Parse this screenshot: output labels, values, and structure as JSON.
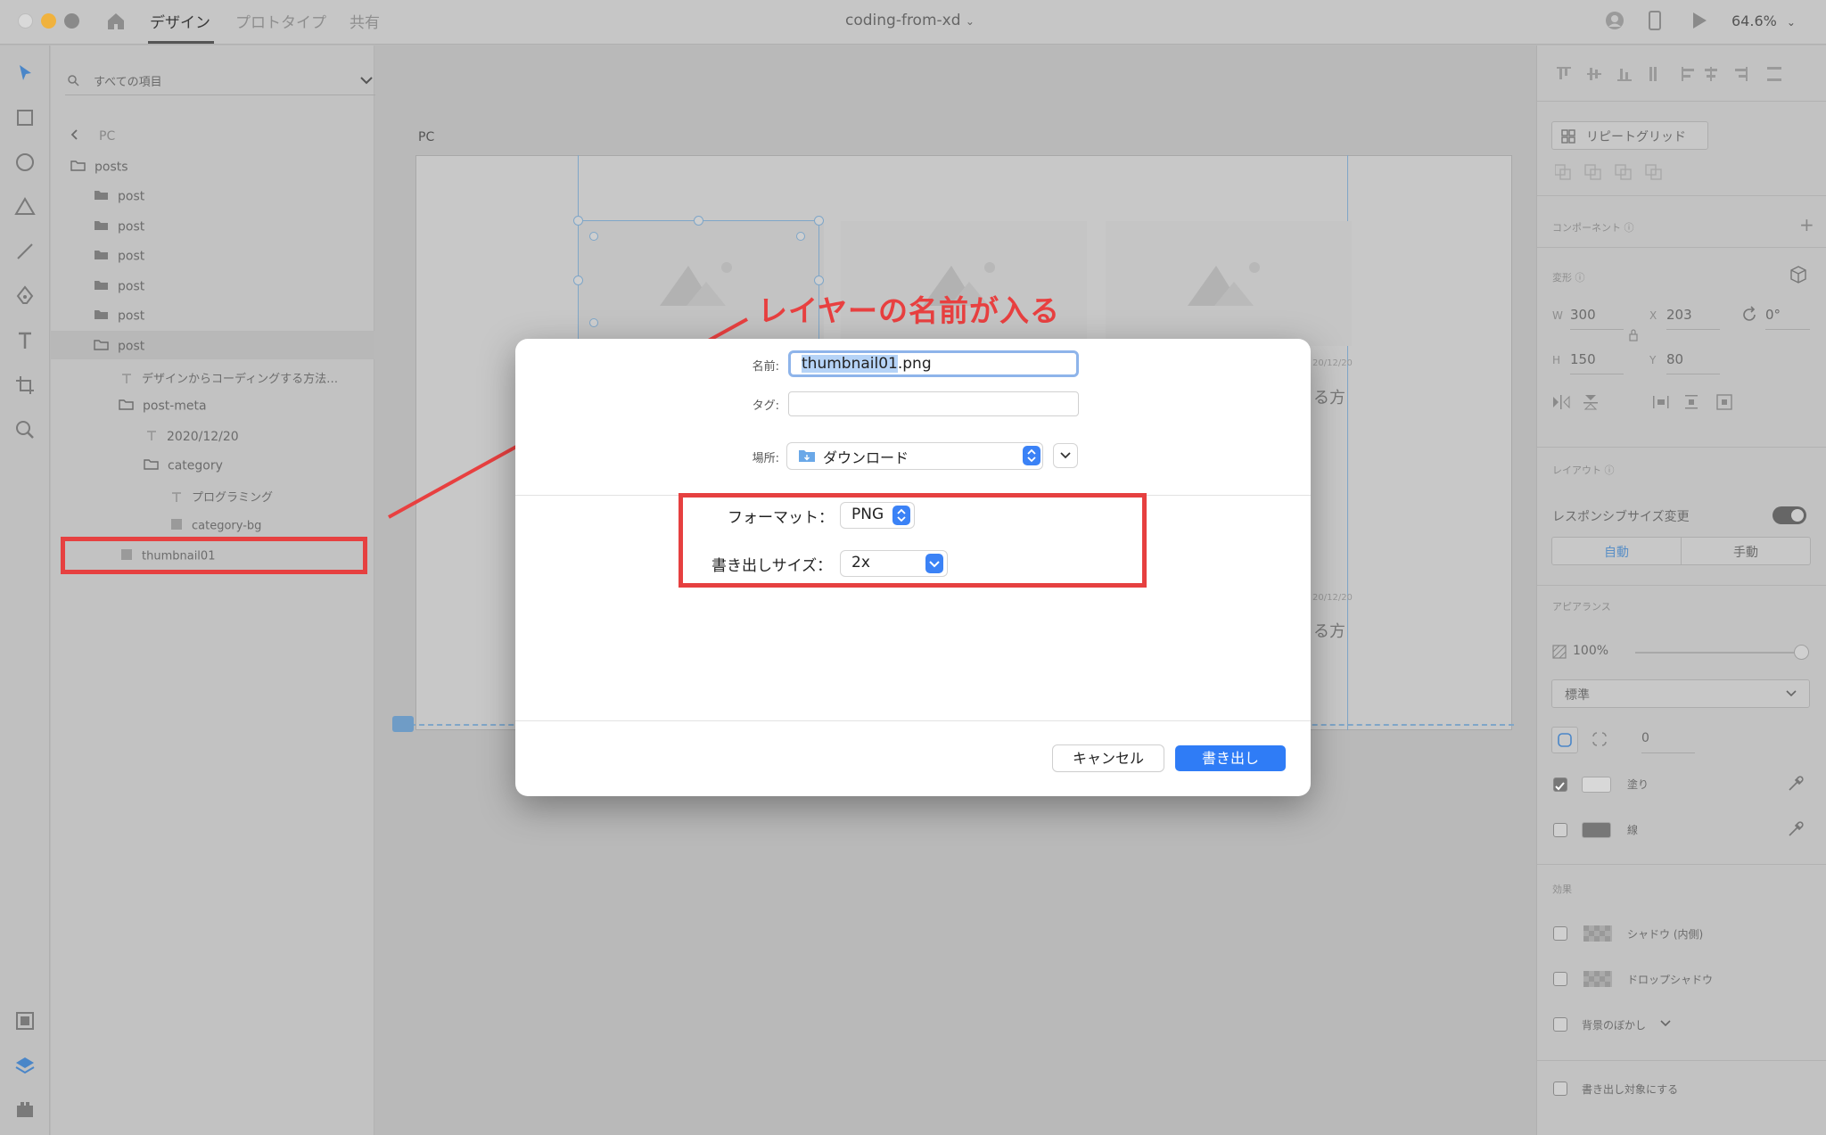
{
  "titlebar": {
    "tabs": [
      "デザイン",
      "プロトタイプ",
      "共有"
    ],
    "doc_title": "coding-from-xd",
    "zoom": "64.6%"
  },
  "layers": {
    "search_placeholder": "すべての項目",
    "items": [
      {
        "label": "PC",
        "icon": "chevron-left-icon"
      },
      {
        "label": "posts",
        "icon": "folder-outline-icon"
      },
      {
        "label": "post",
        "icon": "folder-filled-icon"
      },
      {
        "label": "post",
        "icon": "folder-filled-icon"
      },
      {
        "label": "post",
        "icon": "folder-filled-icon"
      },
      {
        "label": "post",
        "icon": "folder-filled-icon"
      },
      {
        "label": "post",
        "icon": "folder-filled-icon"
      },
      {
        "label": "post",
        "icon": "folder-outline-icon"
      },
      {
        "label": "デザインからコーディングする方法…",
        "icon": "text-layer-icon"
      },
      {
        "label": "post-meta",
        "icon": "folder-outline-icon"
      },
      {
        "label": "2020/12/20",
        "icon": "text-layer-icon"
      },
      {
        "label": "category",
        "icon": "folder-outline-icon"
      },
      {
        "label": "プログラミング",
        "icon": "text-layer-icon"
      },
      {
        "label": "category-bg",
        "icon": "rectangle-layer-icon"
      },
      {
        "label": "thumbnail01",
        "icon": "image-layer-icon"
      }
    ]
  },
  "canvas": {
    "artboard_label": "PC",
    "card_text_1": "る方",
    "card_text_2": "る方",
    "card_date_1": "20/12/20",
    "card_date_2": "20/12/20"
  },
  "annotation": {
    "text": "レイヤーの名前が入る",
    "color": "#e84040"
  },
  "dialog": {
    "name_label": "名前:",
    "name_selected": "thumbnail01",
    "name_ext": ".png",
    "tag_label": "タグ:",
    "location_label": "場所:",
    "location_value": "ダウンロード",
    "format_label": "フォーマット：",
    "format_value": "PNG",
    "size_label": "書き出しサイズ：",
    "size_value": "2x",
    "cancel_label": "キャンセル",
    "export_label": "書き出し",
    "accent": "#2f7cf6"
  },
  "props": {
    "repeat_grid_label": "リピートグリッド",
    "component_label": "コンポーネント",
    "transform_label": "変形",
    "w_label": "W",
    "w_value": "300",
    "x_label": "X",
    "x_value": "203",
    "rotation_value": "0°",
    "h_label": "H",
    "h_value": "150",
    "y_label": "Y",
    "y_value": "80",
    "layout_label": "レイアウト",
    "responsive_label": "レスポンシブサイズ変更",
    "auto_label": "自動",
    "manual_label": "手動",
    "appearance_label": "アピアランス",
    "opacity_value": "100%",
    "blend_value": "標準",
    "radius_value": "0",
    "fill_label": "塗り",
    "stroke_label": "線",
    "effects_label": "効果",
    "inner_shadow_label": "シャドウ (内側)",
    "drop_shadow_label": "ドロップシャドウ",
    "bg_blur_label": "背景のぼかし",
    "export_target_label": "書き出し対象にする"
  }
}
